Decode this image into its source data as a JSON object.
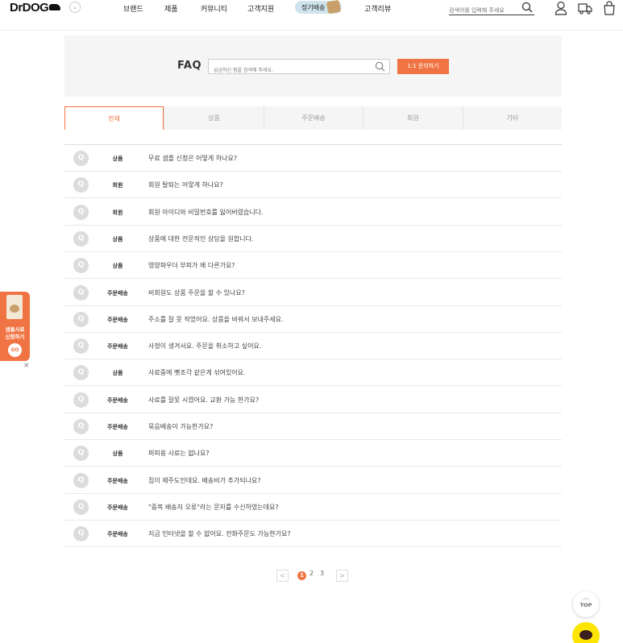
{
  "header": {
    "logo": {
      "text": "DrDOG"
    },
    "nav": [
      "브랜드",
      "제품",
      "커뮤니티",
      "고객지원",
      "정기배송",
      "고객리뷰"
    ],
    "search": {
      "placeholder": "검색어를 입력해 주세요"
    },
    "icons": [
      "search-icon",
      "user-icon",
      "delivery-truck-icon",
      "shopping-bag-icon"
    ]
  },
  "faq": {
    "title": "FAQ",
    "search_placeholder": "궁금하신 점을 검색해 주세요.",
    "ask_button": "1:1 문의하기"
  },
  "tabs": [
    {
      "label": "전체",
      "active": true
    },
    {
      "label": "상품",
      "active": false
    },
    {
      "label": "주문배송",
      "active": false
    },
    {
      "label": "회원",
      "active": false
    },
    {
      "label": "기타",
      "active": false
    }
  ],
  "faq_items": [
    {
      "badge": "Q",
      "category": "상품",
      "question": "무료 샘플 신청은 어떻게 하나요?"
    },
    {
      "badge": "Q",
      "category": "회원",
      "question": "회원 탈퇴는 어떻게 하나요?"
    },
    {
      "badge": "Q",
      "category": "회원",
      "question": "회원 아이디와 비밀번호를 잃어버렸습니다."
    },
    {
      "badge": "Q",
      "category": "상품",
      "question": "상품에 대한 전문적인 상담을 원합니다."
    },
    {
      "badge": "Q",
      "category": "상품",
      "question": "영양파우더 부피가 왜 다른가요?"
    },
    {
      "badge": "Q",
      "category": "주문배송",
      "question": "비회원도 상품 주문을 할 수 있나요?"
    },
    {
      "badge": "Q",
      "category": "주문배송",
      "question": "주소를 잘 못 적었어요. 상품을 바꿔서 보내주세요."
    },
    {
      "badge": "Q",
      "category": "주문배송",
      "question": "사정이 생겨서요. 주문을 취소하고 싶어요."
    },
    {
      "badge": "Q",
      "category": "상품",
      "question": "사료중에 뼛조각 같은게 섞여있어요."
    },
    {
      "badge": "Q",
      "category": "주문배송",
      "question": "사료를 잘못 시켰어요. 교환 가능 한가요?"
    },
    {
      "badge": "Q",
      "category": "주문배송",
      "question": "묶음배송이 가능한가요?"
    },
    {
      "badge": "Q",
      "category": "상품",
      "question": "퍼피용 사료는 없나요?"
    },
    {
      "badge": "Q",
      "category": "주문배송",
      "question": "집이 제주도인데요. 배송비가 추가되나요?"
    },
    {
      "badge": "Q",
      "category": "주문배송",
      "question": "\"중복 배송지 오류\"라는 문자를 수신하였는데요?"
    },
    {
      "badge": "Q",
      "category": "주문배송",
      "question": "지금 인터넷을 할 수 없어요. 전화주문도 가능한가요?"
    }
  ],
  "pagination": {
    "prev": "<",
    "pages": [
      "1",
      "2",
      "3"
    ],
    "current": "1",
    "next": ">"
  },
  "side_banner": {
    "line1": "샘플사료",
    "line2": "신청하기",
    "go": "GO",
    "close": "×"
  },
  "floating": {
    "top_arrow": "︿",
    "top_label": "TOP"
  },
  "colors": {
    "accent": "#f07443",
    "tab_bg": "#f5f5f5",
    "pill_bg": "#cfe4ec"
  }
}
